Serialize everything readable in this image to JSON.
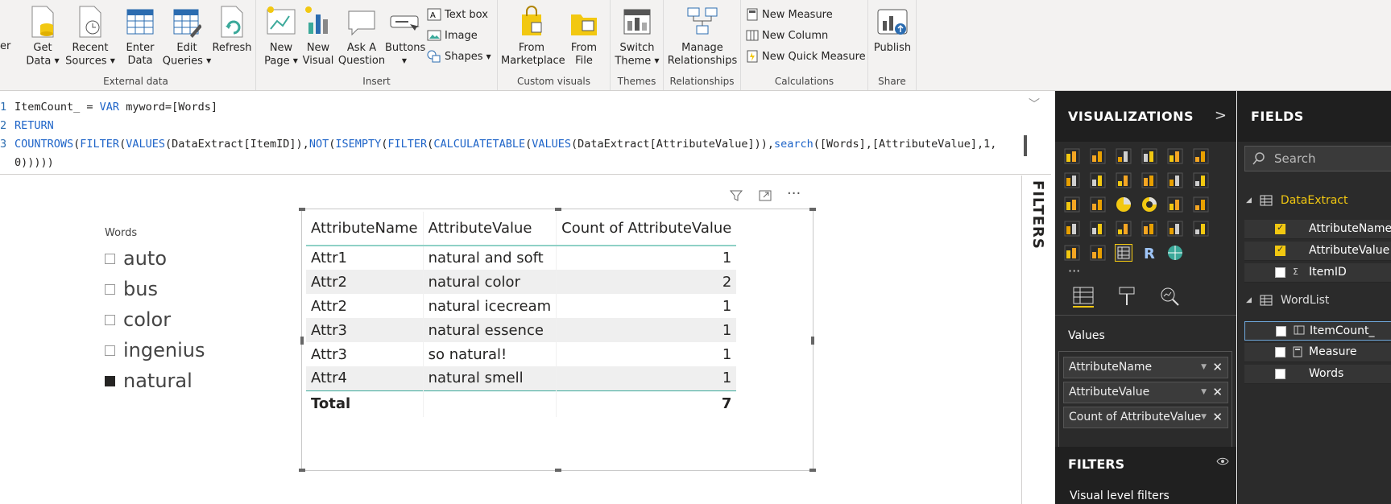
{
  "ribbon": {
    "left_cut": "er",
    "groups": {
      "external_data": "External data",
      "insert": "Insert",
      "custom_visuals": "Custom visuals",
      "themes": "Themes",
      "relationships": "Relationships",
      "calculations": "Calculations",
      "share": "Share"
    },
    "buttons": {
      "get_data": [
        "Get",
        "Data"
      ],
      "recent_sources": [
        "Recent",
        "Sources"
      ],
      "enter_data": [
        "Enter",
        "Data"
      ],
      "edit_queries": [
        "Edit",
        "Queries"
      ],
      "refresh": "Refresh",
      "new_page": [
        "New",
        "Page"
      ],
      "new_visual": [
        "New",
        "Visual"
      ],
      "ask_question": [
        "Ask A",
        "Question"
      ],
      "buttons": "Buttons",
      "text_box": "Text box",
      "image": "Image",
      "shapes": "Shapes",
      "from_marketplace": [
        "From",
        "Marketplace"
      ],
      "from_file": [
        "From",
        "File"
      ],
      "switch_theme": [
        "Switch",
        "Theme"
      ],
      "manage_relationships": [
        "Manage",
        "Relationships"
      ],
      "new_measure": "New Measure",
      "new_column": "New Column",
      "new_quick_measure": "New Quick Measure",
      "publish": "Publish"
    }
  },
  "formula": {
    "line_numbers": [
      "1",
      "2",
      "3"
    ],
    "line1_name": "ItemCount_ = ",
    "line1_var": "VAR",
    "line1_ident": " myword",
    "line1_rest": "=[Words]",
    "line2": "RETURN",
    "line3_fn1": "COUNTROWS",
    "line3_p1": "(",
    "line3_fn2": "FILTER",
    "line3_p2": "(",
    "line3_fn3": "VALUES",
    "line3_p3": "(DataExtract[ItemID]),",
    "line3_fn4": "NOT",
    "line3_p4": "(",
    "line3_fn5": "ISEMPTY",
    "line3_p5": "(",
    "line3_fn6": "FILTER",
    "line3_p6": "(",
    "line3_fn7": "CALCULATETABLE",
    "line3_p7": "(",
    "line3_fn8": "VALUES",
    "line3_p8": "(DataExtract[AttributeValue])),",
    "line3_fn9": "search",
    "line3_p9": "([Words],[AttributeValue],1,",
    "line4": "0)))))"
  },
  "slicer": {
    "title": "Words",
    "items": [
      {
        "label": "auto",
        "checked": false
      },
      {
        "label": "bus",
        "checked": false
      },
      {
        "label": "color",
        "checked": false
      },
      {
        "label": "ingenius",
        "checked": false
      },
      {
        "label": "natural",
        "checked": true
      }
    ]
  },
  "table": {
    "headers": [
      "AttributeName",
      "AttributeValue",
      "Count of AttributeValue"
    ],
    "rows": [
      [
        "Attr1",
        "natural and soft",
        "1"
      ],
      [
        "Attr2",
        "natural color",
        "2"
      ],
      [
        "Attr2",
        "natural icecream",
        "1"
      ],
      [
        "Attr3",
        "natural essence",
        "1"
      ],
      [
        "Attr3",
        "so natural!",
        "1"
      ],
      [
        "Attr4",
        "natural smell",
        "1"
      ]
    ],
    "total_label": "Total",
    "total_value": "7"
  },
  "filters_strip_label": "FILTERS",
  "visualizations": {
    "title": "VISUALIZATIONS",
    "more": "···",
    "values_label": "Values",
    "wells": [
      "AttributeName",
      "AttributeValue",
      "Count of AttributeValue"
    ],
    "filters_title": "FILTERS",
    "visual_level_filters": "Visual level filters"
  },
  "fields": {
    "title": "FIELDS",
    "search_placeholder": "Search",
    "tables": [
      {
        "name": "DataExtract",
        "fields": [
          {
            "name": "AttributeName",
            "checked": true,
            "icon": ""
          },
          {
            "name": "AttributeValue",
            "checked": true,
            "icon": ""
          },
          {
            "name": "ItemID",
            "checked": false,
            "icon": "Σ"
          }
        ]
      },
      {
        "name": "WordList",
        "fields": [
          {
            "name": "ItemCount_",
            "checked": false,
            "icon": "calc-column-icon"
          },
          {
            "name": "Measure",
            "checked": false,
            "icon": "calculator-icon"
          },
          {
            "name": "Words",
            "checked": false,
            "icon": ""
          }
        ]
      }
    ]
  },
  "colors": {
    "accent_yellow": "#f2c811",
    "table_rule": "#3ba99a",
    "pane_bg": "#2b2b2b",
    "ribbon_bg": "#f3f2f1"
  }
}
